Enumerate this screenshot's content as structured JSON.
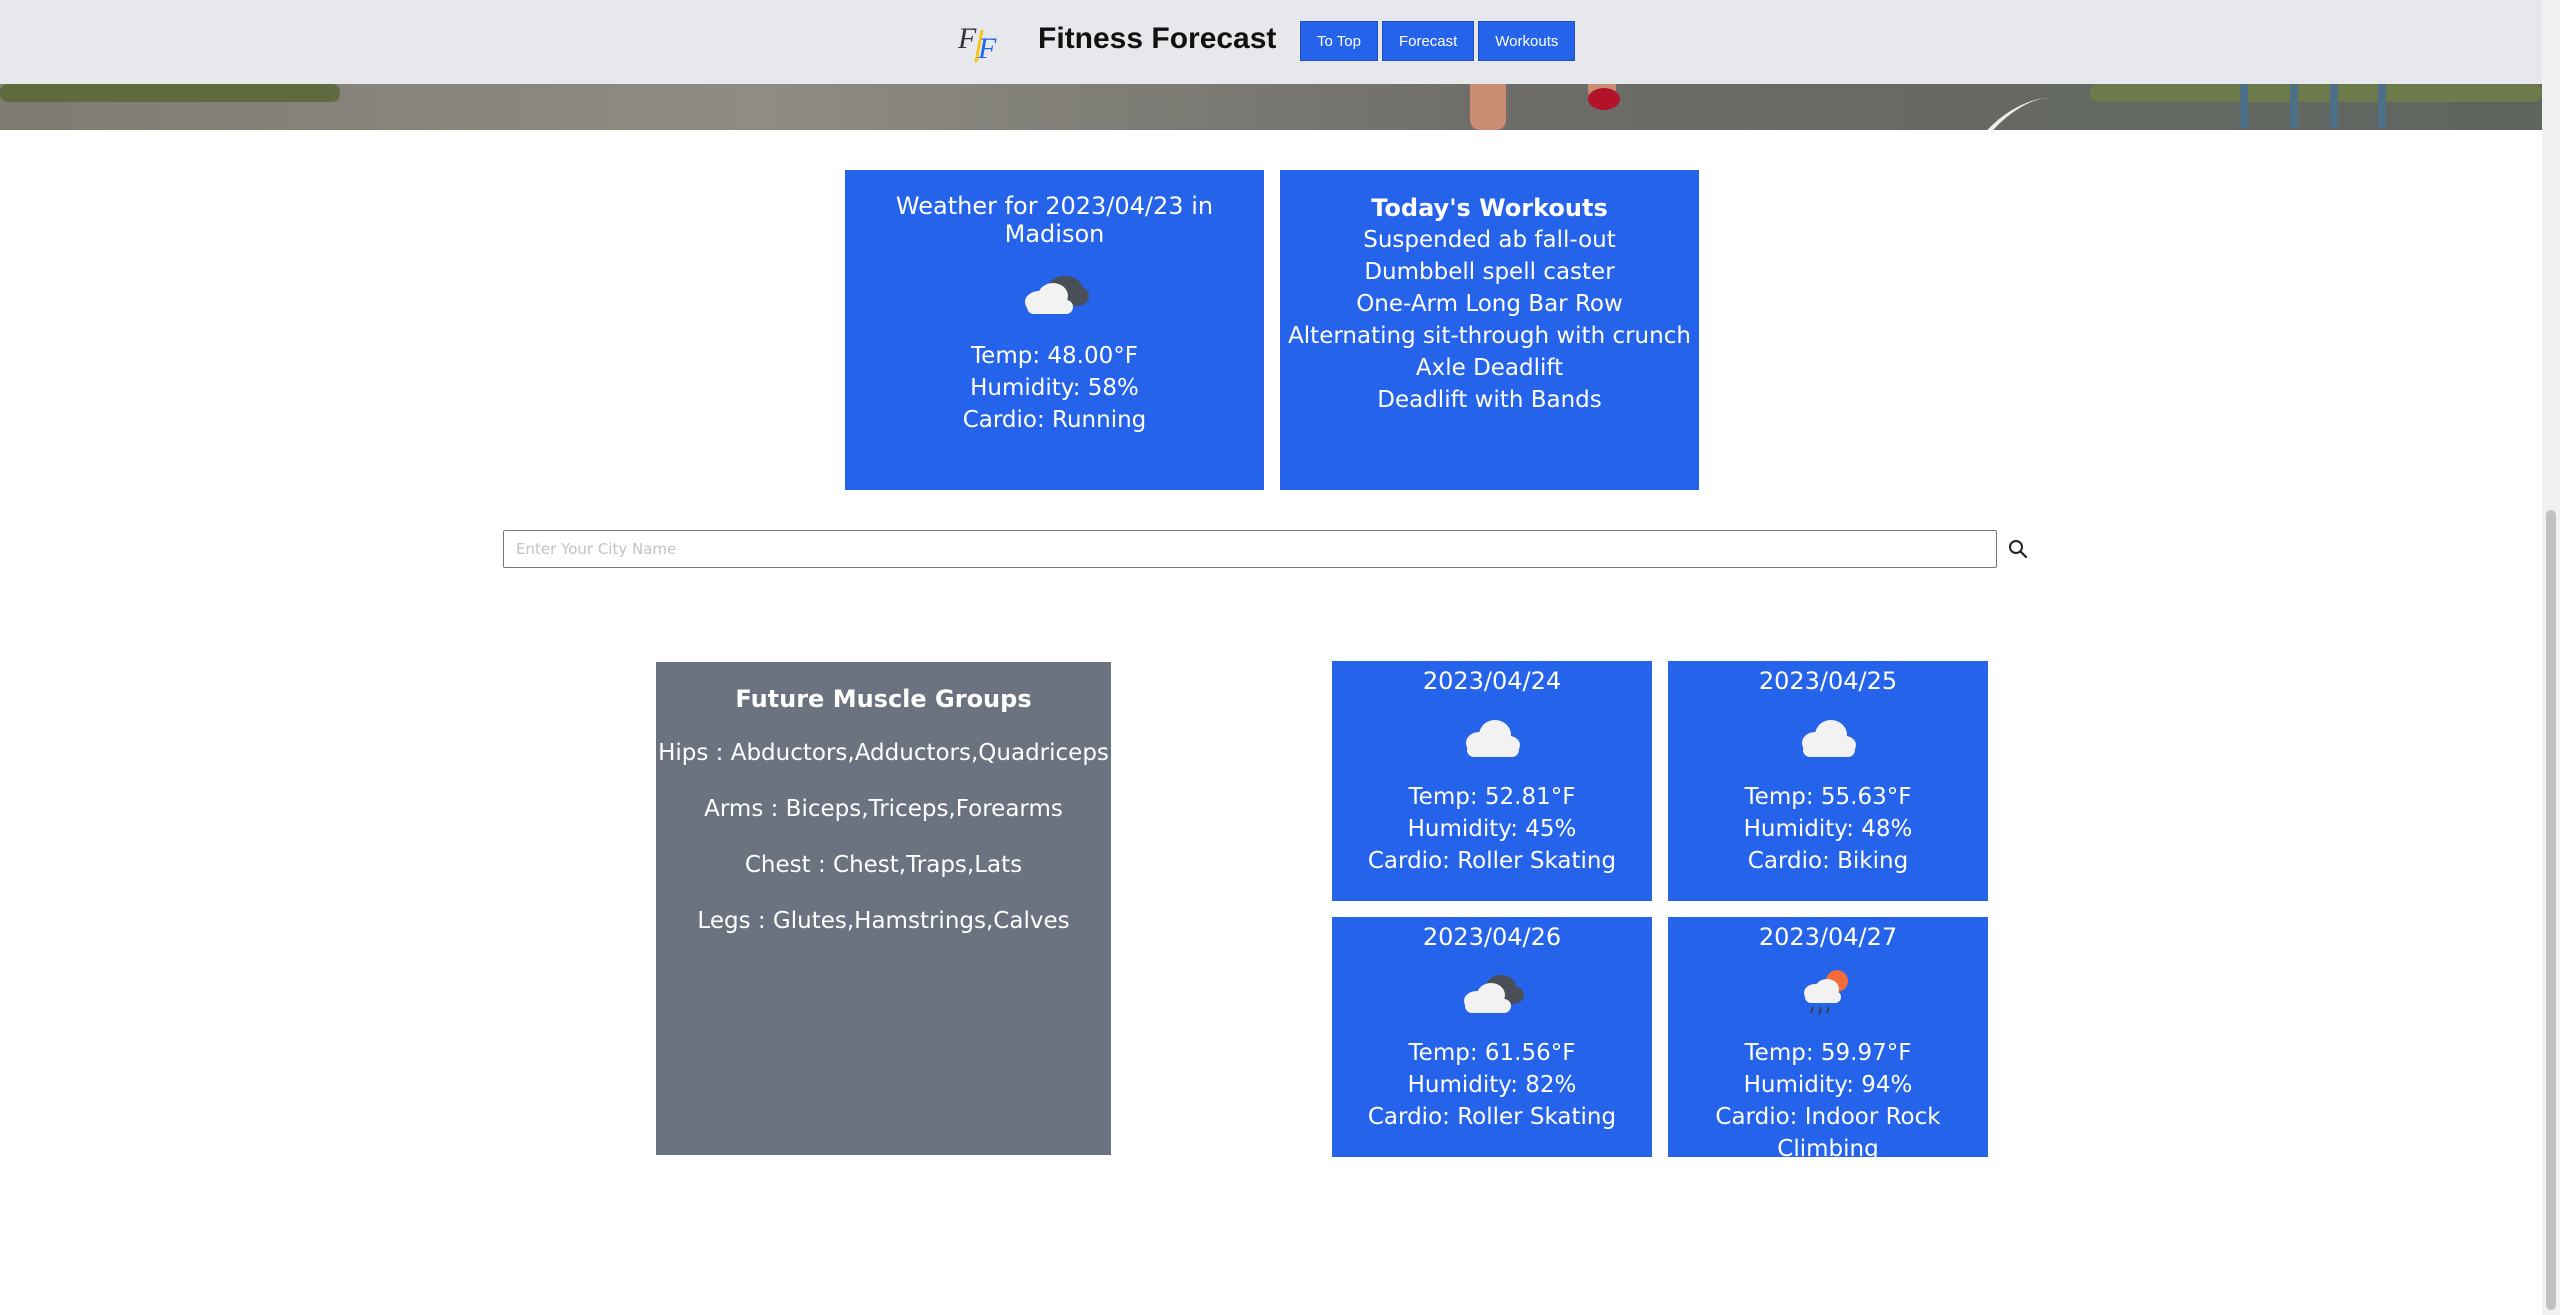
{
  "header": {
    "logo_text": "FF",
    "brand": "Fitness Forecast",
    "nav": [
      {
        "label": "To Top"
      },
      {
        "label": "Forecast"
      },
      {
        "label": "Workouts"
      }
    ]
  },
  "today": {
    "title": "Weather for 2023/04/23 in Madison",
    "icon": "cloudy-icon",
    "temp": "Temp: 48.00°F",
    "humidity": "Humidity: 58%",
    "cardio": "Cardio: Running"
  },
  "workouts": {
    "title": "Today's Workouts",
    "items": [
      "Suspended ab fall-out",
      "Dumbbell spell caster",
      "One-Arm Long Bar Row",
      "Alternating sit-through with crunch",
      "Axle Deadlift",
      "Deadlift with Bands"
    ]
  },
  "search": {
    "placeholder": "Enter Your City Name",
    "value": "",
    "icon": "search-icon"
  },
  "muscles": {
    "title": "Future Muscle Groups",
    "groups": [
      "Hips : Abductors,Adductors,Quadriceps",
      "Arms : Biceps,Triceps,Forearms",
      "Chest : Chest,Traps,Lats",
      "Legs : Glutes,Hamstrings,Calves"
    ]
  },
  "forecast": [
    {
      "date": "2023/04/24",
      "icon": "cloud-icon",
      "temp": "Temp: 52.81°F",
      "humidity": "Humidity: 45%",
      "cardio": "Cardio: Roller Skating"
    },
    {
      "date": "2023/04/25",
      "icon": "cloud-icon",
      "temp": "Temp: 55.63°F",
      "humidity": "Humidity: 48%",
      "cardio": "Cardio: Biking"
    },
    {
      "date": "2023/04/26",
      "icon": "dark-cloud-icon",
      "temp": "Temp: 61.56°F",
      "humidity": "Humidity: 82%",
      "cardio": "Cardio: Roller Skating"
    },
    {
      "date": "2023/04/27",
      "icon": "sun-rain-cloud-icon",
      "temp": "Temp: 59.97°F",
      "humidity": "Humidity: 94%",
      "cardio": "Cardio: Indoor Rock Climbing"
    }
  ],
  "colors": {
    "accent": "#2563eb",
    "muscle_panel": "#6b7280",
    "header_bg": "#e6e8ec"
  }
}
